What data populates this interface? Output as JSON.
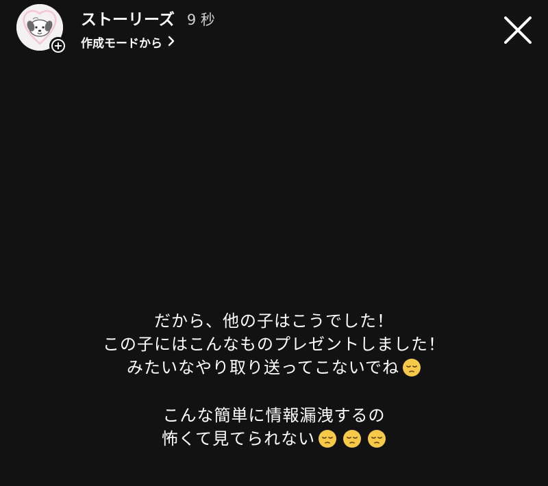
{
  "header": {
    "title": "ストーリーズ",
    "time": "9 秒",
    "mode_label": "作成モードから",
    "avatar_icon": "cute-dog-illustration",
    "add_icon": "plus-circle-icon",
    "chevron_icon": "chevron-right-icon",
    "close_icon": "close-x-icon"
  },
  "message": {
    "paragraph1": {
      "line1": "だから、他の子はこうでした！",
      "line2": "この子にはこんなものプレゼントしました！",
      "line3": "みたいなやり取り送ってこないでね"
    },
    "paragraph2": {
      "line1": "こんな簡単に情報漏洩するの",
      "line2": "怖くて見てられない"
    },
    "emoji": "pensive-face"
  },
  "colors": {
    "background": "#121212",
    "text": "#ffffff",
    "emoji_face": "#f7c948"
  }
}
